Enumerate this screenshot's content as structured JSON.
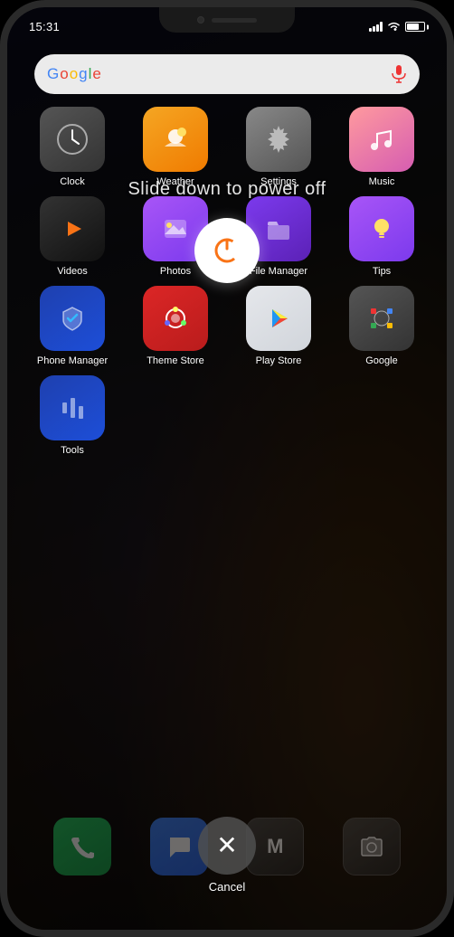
{
  "status_bar": {
    "time": "15:31",
    "signal_text": "signal",
    "wifi_text": "wifi",
    "battery_text": "battery"
  },
  "google_bar": {
    "logo": "Google",
    "mic_label": "microphone"
  },
  "power_overlay": {
    "slide_text": "Slide down to power off",
    "power_button_label": "power button",
    "cancel_label": "Cancel"
  },
  "apps": {
    "row1": [
      {
        "name": "Clock",
        "icon_class": "icon-clock",
        "icon_symbol": "🕐"
      },
      {
        "name": "Weather",
        "icon_class": "icon-weather",
        "icon_symbol": "🌤"
      },
      {
        "name": "Settings",
        "icon_class": "icon-settings",
        "icon_symbol": "⚙"
      },
      {
        "name": "Music",
        "icon_class": "icon-music",
        "icon_symbol": "🎵"
      }
    ],
    "row2": [
      {
        "name": "Videos",
        "icon_class": "icon-videos",
        "icon_symbol": "▶"
      },
      {
        "name": "Photos",
        "icon_class": "icon-photos",
        "icon_symbol": "🖼"
      },
      {
        "name": "File Manager",
        "icon_class": "icon-filemanager",
        "icon_symbol": "📁"
      },
      {
        "name": "Tips",
        "icon_class": "icon-tips",
        "icon_symbol": "💡"
      }
    ],
    "row3": [
      {
        "name": "Phone Manager",
        "icon_class": "icon-phonemanager",
        "icon_symbol": "🛡"
      },
      {
        "name": "Theme Store",
        "icon_class": "icon-themestore",
        "icon_symbol": "🎨"
      },
      {
        "name": "Play Store",
        "icon_class": "icon-playstore",
        "icon_symbol": "▶"
      },
      {
        "name": "Google",
        "icon_class": "icon-google",
        "icon_symbol": "G"
      }
    ],
    "row4": [
      {
        "name": "Tools",
        "icon_class": "icon-tools",
        "icon_symbol": "🔧"
      }
    ]
  },
  "dock": {
    "items": [
      {
        "name": "Phone",
        "icon_class": "dock-phone",
        "symbol": "📞"
      },
      {
        "name": "Messages",
        "icon_class": "dock-messages",
        "symbol": "💬"
      },
      {
        "name": "Mi",
        "icon_class": "dock-mi",
        "symbol": "M"
      },
      {
        "name": "Camera",
        "icon_class": "dock-camera",
        "symbol": "📷"
      }
    ]
  }
}
